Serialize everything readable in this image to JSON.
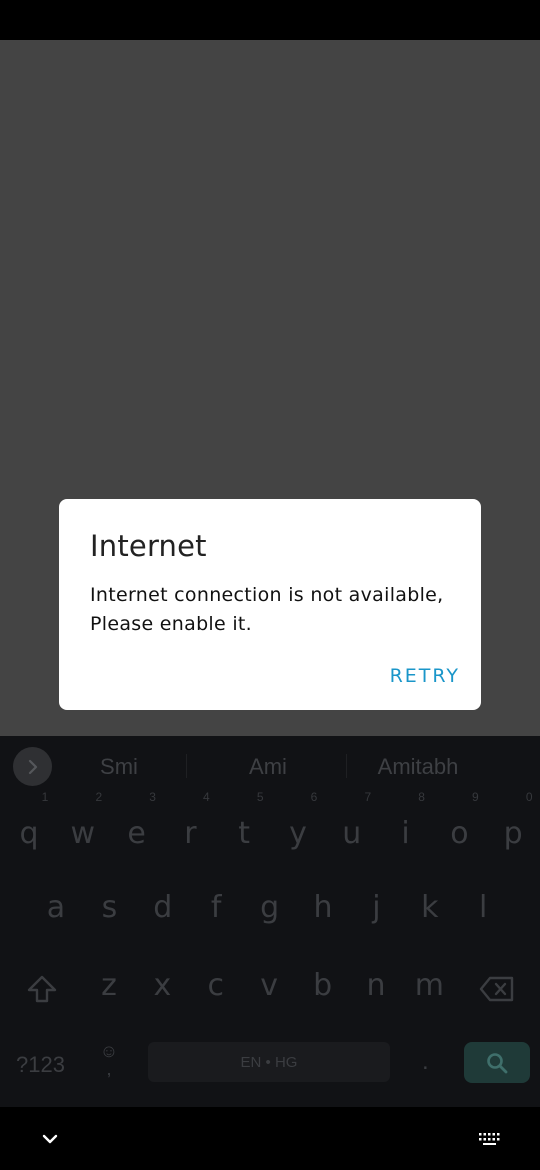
{
  "dialog": {
    "title": "Internet",
    "message": "Internet connection is not available,\nPlease enable it.",
    "retry_label": "RETRY"
  },
  "keyboard": {
    "suggestions": [
      "Smi",
      "Ami",
      "Amitabh"
    ],
    "row1": [
      "q",
      "w",
      "e",
      "r",
      "t",
      "y",
      "u",
      "i",
      "o",
      "p"
    ],
    "row1_hints": [
      "1",
      "2",
      "3",
      "4",
      "5",
      "6",
      "7",
      "8",
      "9",
      "0"
    ],
    "row2": [
      "a",
      "s",
      "d",
      "f",
      "g",
      "h",
      "j",
      "k",
      "l"
    ],
    "row3": [
      "z",
      "x",
      "c",
      "v",
      "b",
      "n",
      "m"
    ],
    "symbols_label": "?123",
    "emoji_comma": ",",
    "space_label": "EN • HG",
    "period_label": "."
  },
  "colors": {
    "accent": "#1a96c9",
    "scrim": "#444444"
  }
}
